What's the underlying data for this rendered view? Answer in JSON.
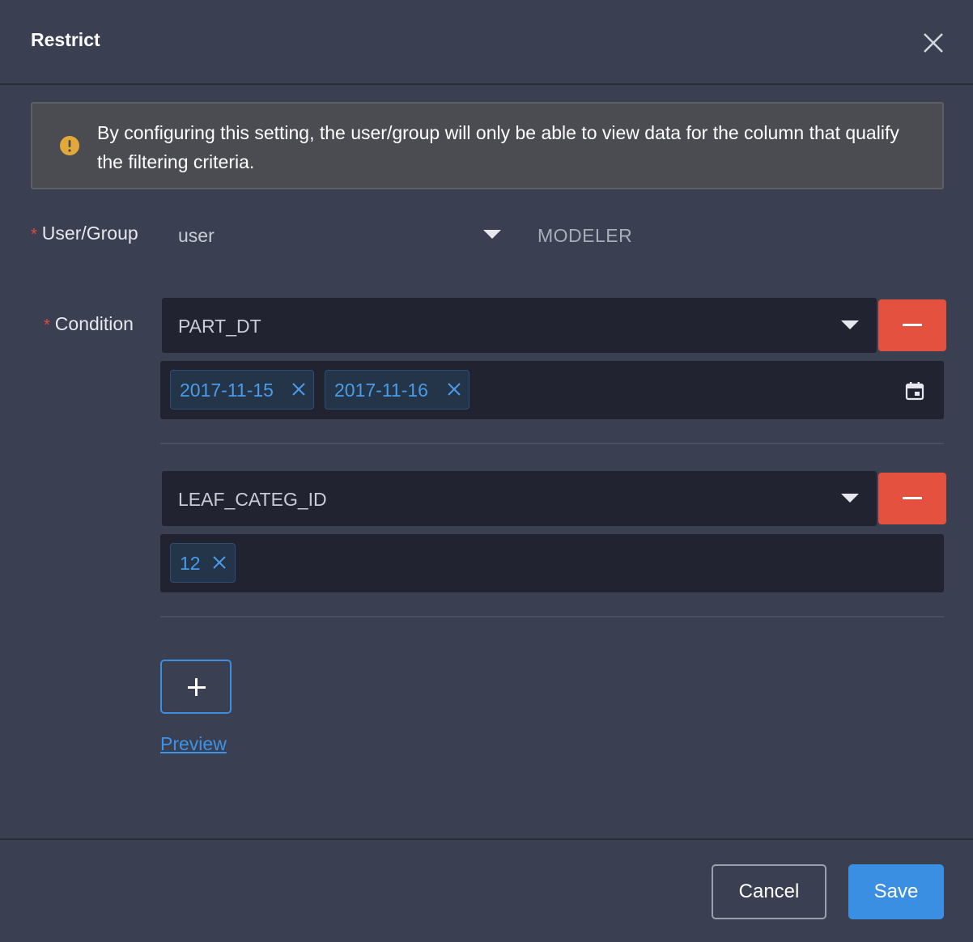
{
  "dialog": {
    "title": "Restrict"
  },
  "alert": {
    "text": "By configuring this setting, the user/group will only be able to view data for the column that qualify the filtering criteria."
  },
  "form": {
    "required_mark": "*",
    "user_group": {
      "label": "User/Group",
      "type_value": "user",
      "name_value": "MODELER"
    },
    "condition_label": "Condition",
    "conditions": [
      {
        "column": "PART_DT",
        "values": [
          "2017-11-15",
          "2017-11-16"
        ],
        "input_icon": "calendar-icon"
      },
      {
        "column": "LEAF_CATEG_ID",
        "values": [
          "12"
        ]
      }
    ],
    "preview_link": "Preview"
  },
  "footer": {
    "cancel_label": "Cancel",
    "save_label": "Save"
  },
  "colors": {
    "background": "#3a3f51",
    "accent": "#3b8fe2",
    "danger": "#e4513f",
    "warning": "#e2a93a",
    "tag_text": "#4a9ce8"
  }
}
